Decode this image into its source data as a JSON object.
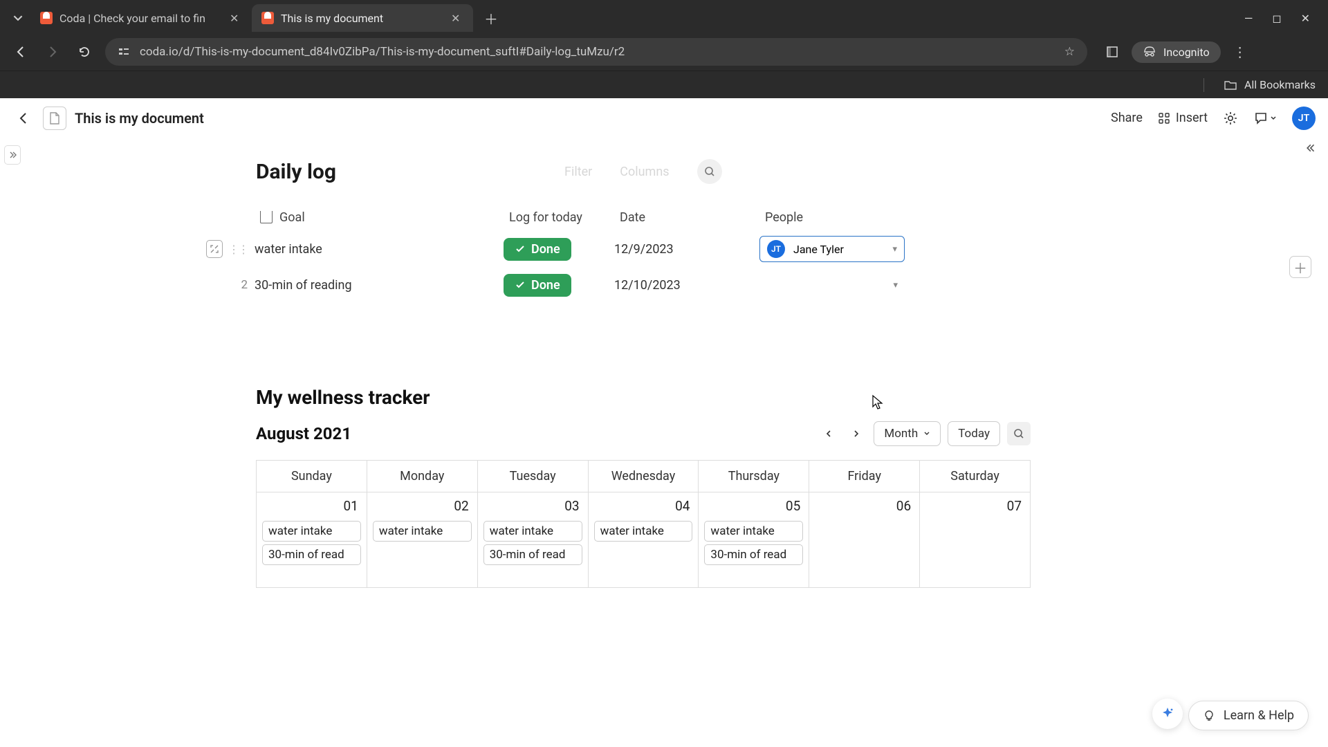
{
  "browser": {
    "tabs": [
      {
        "title": "Coda | Check your email to fin"
      },
      {
        "title": "This is my document"
      }
    ],
    "url": "coda.io/d/This-is-my-document_d84Iv0ZibPa/This-is-my-document_suftI#Daily-log_tuMzu/r2",
    "incognito_label": "Incognito",
    "all_bookmarks": "All Bookmarks"
  },
  "header": {
    "doc_title": "This is my document",
    "share": "Share",
    "insert": "Insert",
    "avatar": "JT"
  },
  "daily_log": {
    "title": "Daily log",
    "filter": "Filter",
    "columns": "Columns",
    "headers": {
      "goal": "Goal",
      "log": "Log for today",
      "date": "Date",
      "people": "People"
    },
    "rows": [
      {
        "num": "",
        "goal": "water intake",
        "done": "Done",
        "date": "12/9/2023",
        "person": "Jane Tyler",
        "person_initials": "JT",
        "has_person": true,
        "show_pre": true
      },
      {
        "num": "2",
        "goal": "30-min of reading",
        "done": "Done",
        "date": "12/10/2023",
        "person": "",
        "person_initials": "",
        "has_person": false,
        "show_pre": false
      }
    ]
  },
  "tracker": {
    "title": "My wellness tracker",
    "month": "August 2021",
    "view_label": "Month",
    "today": "Today",
    "dow": [
      "Sunday",
      "Monday",
      "Tuesday",
      "Wednesday",
      "Thursday",
      "Friday",
      "Saturday"
    ],
    "week1": [
      {
        "d": "01",
        "events": [
          "water intake",
          "30-min of read"
        ]
      },
      {
        "d": "02",
        "events": [
          "water intake"
        ]
      },
      {
        "d": "03",
        "events": [
          "water intake",
          "30-min of read"
        ]
      },
      {
        "d": "04",
        "events": [
          "water intake"
        ]
      },
      {
        "d": "05",
        "events": [
          "water intake",
          "30-min of read"
        ]
      },
      {
        "d": "06",
        "events": []
      },
      {
        "d": "07",
        "events": []
      }
    ]
  },
  "help": {
    "label": "Learn & Help"
  }
}
